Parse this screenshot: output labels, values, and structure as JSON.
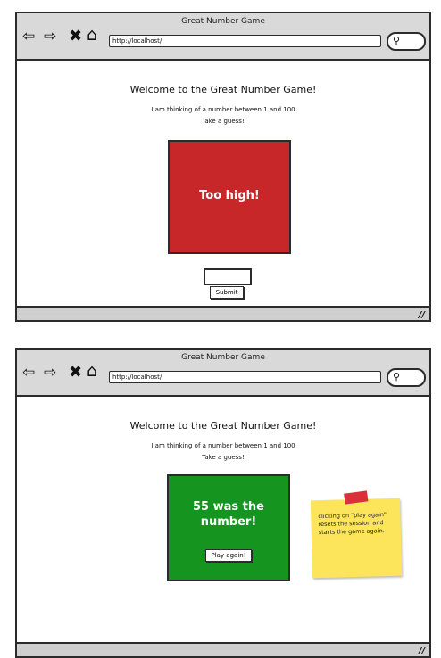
{
  "browser": {
    "title": "Great Number Game",
    "url": "http://localhost/",
    "nav_icons": [
      "back-arrow-icon",
      "forward-arrow-icon",
      "stop-icon",
      "home-icon"
    ],
    "search_icon": "magnifier-icon"
  },
  "page": {
    "welcome": "Welcome to the Great Number Game!",
    "description_line1": "I am thinking of a number between 1 and 100",
    "description_line2": "Take a guess!"
  },
  "screen_too_high": {
    "result_message": "Too high!",
    "result_color": "#c8272a",
    "guess_input_value": "",
    "submit_label": "Submit"
  },
  "screen_correct": {
    "result_line1": "55 was the",
    "result_line2": "number!",
    "result_color": "#15951f",
    "play_again_label": "Play again!"
  },
  "sticky_note": {
    "text": "clicking on \"play again\" resets the session and starts the game again.",
    "color": "#fce55a"
  }
}
